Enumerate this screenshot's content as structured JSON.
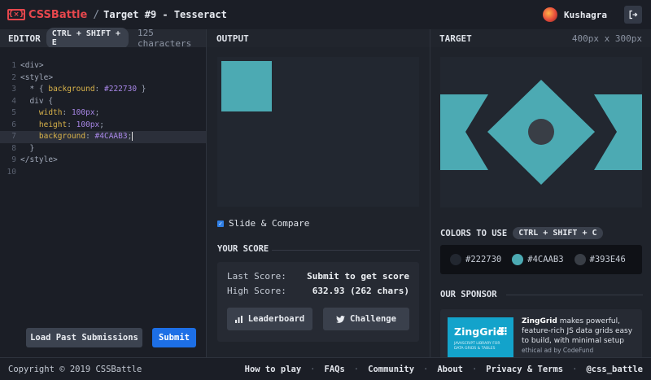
{
  "header": {
    "logo_text": "CSSBattle",
    "logo_mark": "{×}",
    "separator": "/",
    "target_title": "Target #9 - Tesseract",
    "user_name": "Kushagra"
  },
  "editor": {
    "title": "EDITOR",
    "shortcut": "CTRL + SHIFT + E",
    "char_count": "125 characters",
    "lines": [
      {
        "n": "1",
        "indent": "",
        "parts": [
          [
            "tag",
            "<div>"
          ]
        ]
      },
      {
        "n": "2",
        "indent": "",
        "parts": [
          [
            "tag",
            "<style>"
          ]
        ]
      },
      {
        "n": "3",
        "indent": "  ",
        "parts": [
          [
            "punc",
            "* { "
          ],
          [
            "prop",
            "background"
          ],
          [
            "punc",
            ": "
          ],
          [
            "val",
            "#222730"
          ],
          [
            "punc",
            " }"
          ]
        ]
      },
      {
        "n": "4",
        "indent": "  ",
        "parts": [
          [
            "punc",
            "div {"
          ]
        ]
      },
      {
        "n": "5",
        "indent": "    ",
        "parts": [
          [
            "prop",
            "width"
          ],
          [
            "punc",
            ": "
          ],
          [
            "val",
            "100px"
          ],
          [
            "punc",
            ";"
          ]
        ]
      },
      {
        "n": "6",
        "indent": "    ",
        "parts": [
          [
            "prop",
            "height"
          ],
          [
            "punc",
            ": "
          ],
          [
            "val",
            "100px"
          ],
          [
            "punc",
            ";"
          ]
        ]
      },
      {
        "n": "7",
        "indent": "    ",
        "parts": [
          [
            "prop",
            "background"
          ],
          [
            "punc",
            ": "
          ],
          [
            "val",
            "#4CAAB3"
          ],
          [
            "punc",
            ";"
          ]
        ],
        "active": true
      },
      {
        "n": "8",
        "indent": "  ",
        "parts": [
          [
            "punc",
            "}"
          ]
        ]
      },
      {
        "n": "9",
        "indent": "",
        "parts": [
          [
            "tag",
            "</style>"
          ]
        ]
      },
      {
        "n": "10",
        "indent": "",
        "parts": []
      }
    ],
    "load_button": "Load Past Submissions",
    "submit_button": "Submit"
  },
  "output": {
    "title": "OUTPUT",
    "slide_compare_label": "Slide & Compare",
    "slide_compare_checked": true,
    "score_title": "YOUR SCORE",
    "last_score_label": "Last Score:",
    "last_score_value": "Submit to get score",
    "high_score_label": "High Score:",
    "high_score_value": "632.93 (262 chars)",
    "leaderboard_button": "Leaderboard",
    "challenge_button": "Challenge"
  },
  "target": {
    "title": "TARGET",
    "size": "400px x 300px",
    "colors_title": "COLORS TO USE",
    "colors_shortcut": "CTRL + SHIFT + C",
    "colors": [
      {
        "hex": "#222730",
        "label": "#222730"
      },
      {
        "hex": "#4CAAB3",
        "label": "#4CAAB3"
      },
      {
        "hex": "#393E46",
        "label": "#393E46"
      }
    ],
    "sponsor_title": "OUR SPONSOR",
    "sponsor_image_title": "ZingGrid",
    "sponsor_image_sub": "JAVASCRIPT LIBRARY FOR DATA GRIDS & TABLES",
    "sponsor_name": "ZingGrid",
    "sponsor_text": " makes powerful, feature-rich JS data grids easy to build, with minimal setup",
    "sponsor_ethical": "ethical ad by CodeFund"
  },
  "footer": {
    "copyright": "Copyright © 2019 CSSBattle",
    "links": [
      "How to play",
      "FAQs",
      "Community",
      "About",
      "Privacy & Terms",
      "@css_battle"
    ]
  },
  "colors": {
    "accent": "#4CAAB3",
    "background": "#222730",
    "shape": "#393E46",
    "submit": "#1d6fe6",
    "brand": "#e6474d"
  }
}
